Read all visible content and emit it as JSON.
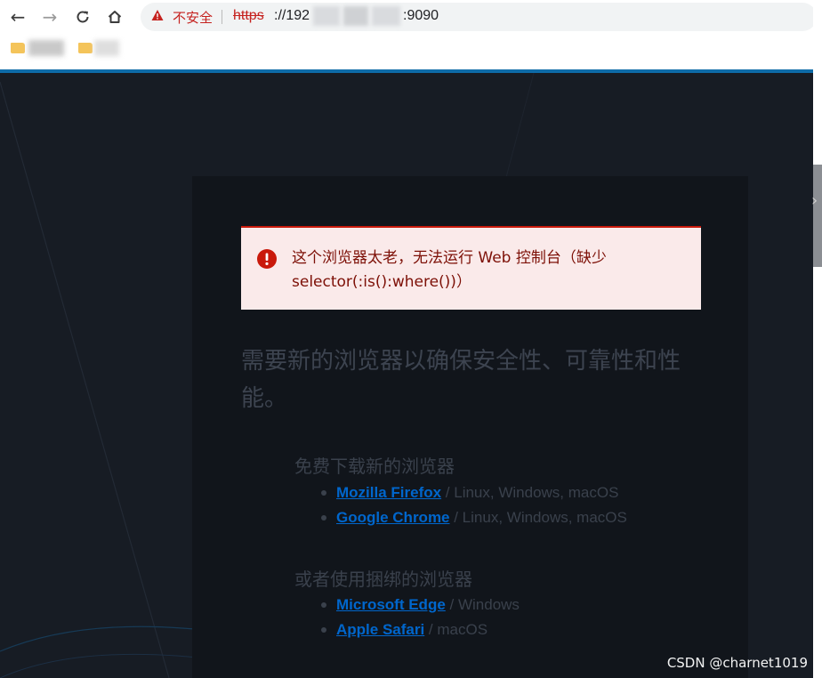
{
  "browser": {
    "security_label": "不安全",
    "url_scheme": "https",
    "url_host_start": "://192",
    "url_port": ":9090"
  },
  "alert": {
    "message": "这个浏览器太老，无法运行 Web 控制台（缺少 selector(:is():where())）"
  },
  "main": {
    "heading": "需要新的浏览器以确保安全性、可靠性和性能。",
    "sections": [
      {
        "title": "免费下载新的浏览器",
        "browsers": [
          {
            "name": "Mozilla Firefox",
            "platforms": " / Linux, Windows, macOS"
          },
          {
            "name": "Google Chrome",
            "platforms": " / Linux, Windows, macOS"
          }
        ]
      },
      {
        "title": "或者使用捆绑的浏览器",
        "browsers": [
          {
            "name": "Microsoft Edge",
            "platforms": " / Windows"
          },
          {
            "name": "Apple Safari",
            "platforms": " / macOS"
          }
        ]
      }
    ]
  },
  "watermark": "CSDN @charnet1019",
  "colors": {
    "danger": "#c9190b",
    "link": "#0066cc",
    "background": "#151a22",
    "accent": "#0e6ba8"
  }
}
